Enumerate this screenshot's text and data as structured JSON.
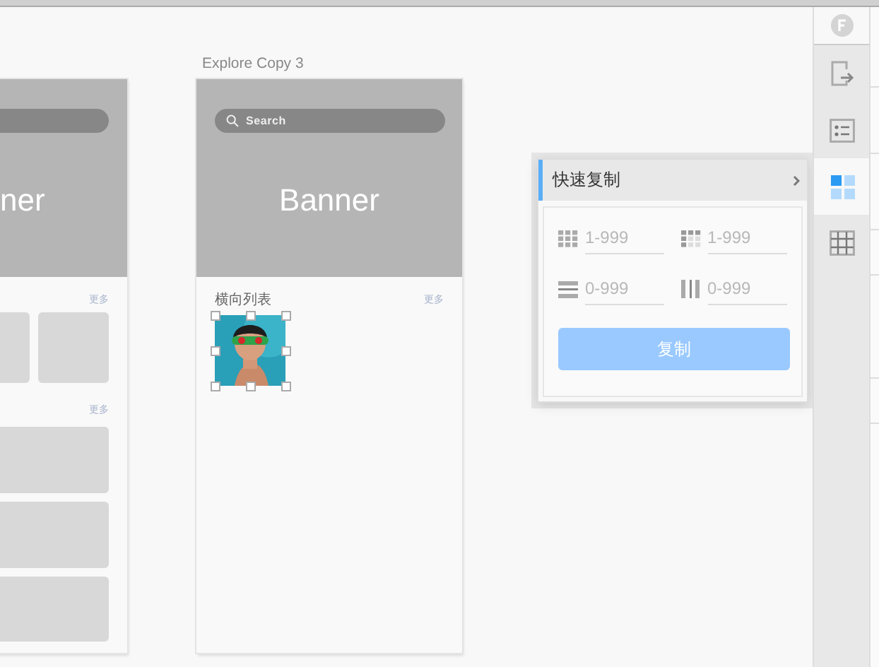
{
  "canvas": {
    "left_artboard": {
      "banner_text": "ner",
      "more_links": [
        "更多",
        "更多"
      ]
    },
    "right_artboard": {
      "title": "Explore Copy 3",
      "search": {
        "placeholder": "Search"
      },
      "banner_text": "Banner",
      "section_title": "横向列表",
      "more_link": "更多",
      "image": {
        "kind": "picture",
        "selected": true
      }
    }
  },
  "quick_copy_panel": {
    "title": "快速复制",
    "fields": [
      {
        "kind": "grid",
        "placeholder": "1-999"
      },
      {
        "kind": "grid-corner",
        "placeholder": "1-999"
      },
      {
        "kind": "row-gap",
        "placeholder": "0-999"
      },
      {
        "kind": "col-gap",
        "placeholder": "0-999"
      }
    ],
    "button": "复制"
  },
  "sidebar": {
    "tools": [
      {
        "kind": "export",
        "selected": false
      },
      {
        "kind": "list",
        "selected": false
      },
      {
        "kind": "tiles",
        "selected": true
      },
      {
        "kind": "table",
        "selected": false
      }
    ]
  }
}
